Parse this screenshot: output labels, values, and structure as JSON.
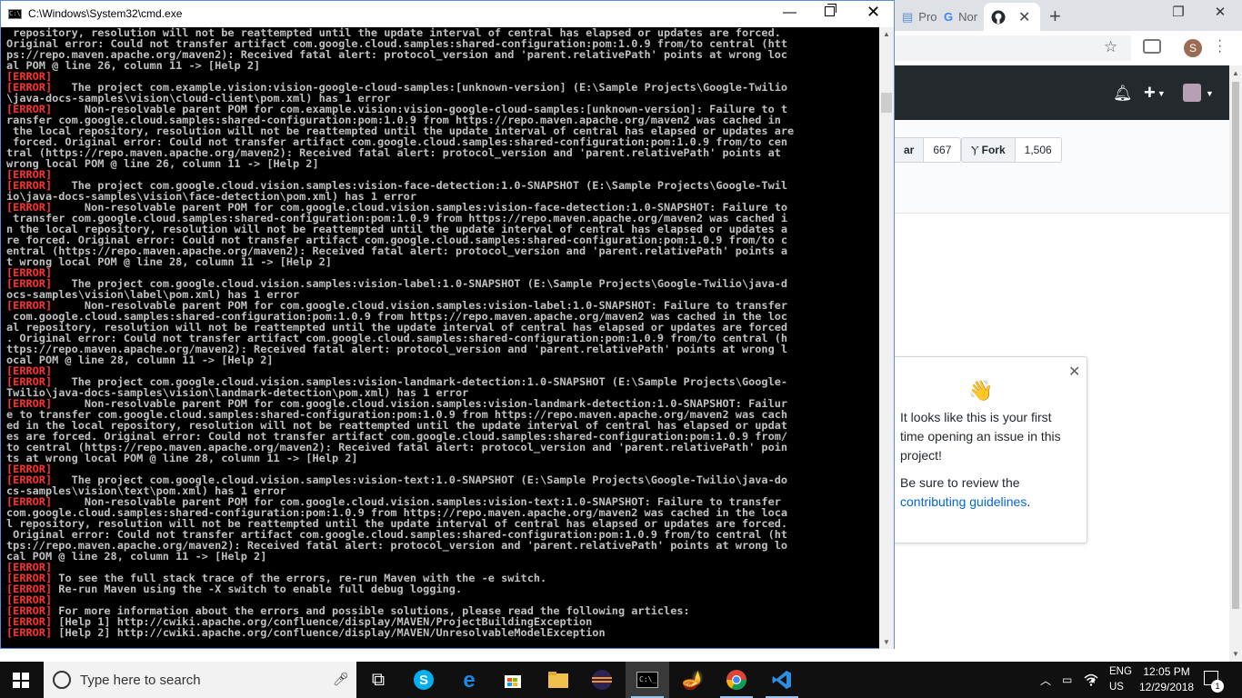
{
  "chrome": {
    "tabs": [
      {
        "label": "Pro"
      },
      {
        "label": "Nor"
      },
      {
        "label": ""
      }
    ],
    "new_tab": "+",
    "avatar_letter": "S"
  },
  "github": {
    "star_label": "ar",
    "star_count": "667",
    "fork_label": "Fork",
    "fork_count": "1,506",
    "popover": {
      "text1": "It looks like this is your first time opening an issue in this project!",
      "text2_pre": "Be sure to review the ",
      "text2_link": "contributing guidelines",
      "text2_post": "."
    }
  },
  "cmd": {
    "title": "C:\\Windows\\System32\\cmd.exe",
    "lines": [
      {
        "tag": "",
        "text": " repository, resolution will not be reattempted until the update interval of central has elapsed or updates are forced."
      },
      {
        "tag": "",
        "text": "Original error: Could not transfer artifact com.google.cloud.samples:shared-configuration:pom:1.0.9 from/to central (htt"
      },
      {
        "tag": "",
        "text": "ps://repo.maven.apache.org/maven2): Received fatal alert: protocol_version and 'parent.relativePath' points at wrong loc"
      },
      {
        "tag": "",
        "text": "al POM @ line 26, column 11 -> [Help 2]"
      },
      {
        "tag": "[ERROR]",
        "text": ""
      },
      {
        "tag": "[ERROR]",
        "text": "   The project com.example.vision:vision-google-cloud-samples:[unknown-version] (E:\\Sample Projects\\Google-Twilio"
      },
      {
        "tag": "",
        "text": "\\java-docs-samples\\vision\\cloud-client\\pom.xml) has 1 error"
      },
      {
        "tag": "[ERROR]",
        "text": "     Non-resolvable parent POM for com.example.vision:vision-google-cloud-samples:[unknown-version]: Failure to t"
      },
      {
        "tag": "",
        "text": "ransfer com.google.cloud.samples:shared-configuration:pom:1.0.9 from https://repo.maven.apache.org/maven2 was cached in"
      },
      {
        "tag": "",
        "text": " the local repository, resolution will not be reattempted until the update interval of central has elapsed or updates are"
      },
      {
        "tag": "",
        "text": " forced. Original error: Could not transfer artifact com.google.cloud.samples:shared-configuration:pom:1.0.9 from/to cen"
      },
      {
        "tag": "",
        "text": "tral (https://repo.maven.apache.org/maven2): Received fatal alert: protocol_version and 'parent.relativePath' points at"
      },
      {
        "tag": "",
        "text": "wrong local POM @ line 26, column 11 -> [Help 2]"
      },
      {
        "tag": "[ERROR]",
        "text": ""
      },
      {
        "tag": "[ERROR]",
        "text": "   The project com.google.cloud.vision.samples:vision-face-detection:1.0-SNAPSHOT (E:\\Sample Projects\\Google-Twil"
      },
      {
        "tag": "",
        "text": "io\\java-docs-samples\\vision\\face-detection\\pom.xml) has 1 error"
      },
      {
        "tag": "[ERROR]",
        "text": "     Non-resolvable parent POM for com.google.cloud.vision.samples:vision-face-detection:1.0-SNAPSHOT: Failure to"
      },
      {
        "tag": "",
        "text": " transfer com.google.cloud.samples:shared-configuration:pom:1.0.9 from https://repo.maven.apache.org/maven2 was cached i"
      },
      {
        "tag": "",
        "text": "n the local repository, resolution will not be reattempted until the update interval of central has elapsed or updates a"
      },
      {
        "tag": "",
        "text": "re forced. Original error: Could not transfer artifact com.google.cloud.samples:shared-configuration:pom:1.0.9 from/to c"
      },
      {
        "tag": "",
        "text": "entral (https://repo.maven.apache.org/maven2): Received fatal alert: protocol_version and 'parent.relativePath' points a"
      },
      {
        "tag": "",
        "text": "t wrong local POM @ line 28, column 11 -> [Help 2]"
      },
      {
        "tag": "[ERROR]",
        "text": ""
      },
      {
        "tag": "[ERROR]",
        "text": "   The project com.google.cloud.vision.samples:vision-label:1.0-SNAPSHOT (E:\\Sample Projects\\Google-Twilio\\java-d"
      },
      {
        "tag": "",
        "text": "ocs-samples\\vision\\label\\pom.xml) has 1 error"
      },
      {
        "tag": "[ERROR]",
        "text": "     Non-resolvable parent POM for com.google.cloud.vision.samples:vision-label:1.0-SNAPSHOT: Failure to transfer"
      },
      {
        "tag": "",
        "text": " com.google.cloud.samples:shared-configuration:pom:1.0.9 from https://repo.maven.apache.org/maven2 was cached in the loc"
      },
      {
        "tag": "",
        "text": "al repository, resolution will not be reattempted until the update interval of central has elapsed or updates are forced"
      },
      {
        "tag": "",
        "text": ". Original error: Could not transfer artifact com.google.cloud.samples:shared-configuration:pom:1.0.9 from/to central (h"
      },
      {
        "tag": "",
        "text": "ttps://repo.maven.apache.org/maven2): Received fatal alert: protocol_version and 'parent.relativePath' points at wrong l"
      },
      {
        "tag": "",
        "text": "ocal POM @ line 28, column 11 -> [Help 2]"
      },
      {
        "tag": "[ERROR]",
        "text": ""
      },
      {
        "tag": "[ERROR]",
        "text": "   The project com.google.cloud.vision.samples:vision-landmark-detection:1.0-SNAPSHOT (E:\\Sample Projects\\Google-"
      },
      {
        "tag": "",
        "text": "Twilio\\java-docs-samples\\vision\\landmark-detection\\pom.xml) has 1 error"
      },
      {
        "tag": "[ERROR]",
        "text": "     Non-resolvable parent POM for com.google.cloud.vision.samples:vision-landmark-detection:1.0-SNAPSHOT: Failur"
      },
      {
        "tag": "",
        "text": "e to transfer com.google.cloud.samples:shared-configuration:pom:1.0.9 from https://repo.maven.apache.org/maven2 was cach"
      },
      {
        "tag": "",
        "text": "ed in the local repository, resolution will not be reattempted until the update interval of central has elapsed or updat"
      },
      {
        "tag": "",
        "text": "es are forced. Original error: Could not transfer artifact com.google.cloud.samples:shared-configuration:pom:1.0.9 from/"
      },
      {
        "tag": "",
        "text": "to central (https://repo.maven.apache.org/maven2): Received fatal alert: protocol_version and 'parent.relativePath' poin"
      },
      {
        "tag": "",
        "text": "ts at wrong local POM @ line 28, column 11 -> [Help 2]"
      },
      {
        "tag": "[ERROR]",
        "text": ""
      },
      {
        "tag": "[ERROR]",
        "text": "   The project com.google.cloud.vision.samples:vision-text:1.0-SNAPSHOT (E:\\Sample Projects\\Google-Twilio\\java-do"
      },
      {
        "tag": "",
        "text": "cs-samples\\vision\\text\\pom.xml) has 1 error"
      },
      {
        "tag": "[ERROR]",
        "text": "     Non-resolvable parent POM for com.google.cloud.vision.samples:vision-text:1.0-SNAPSHOT: Failure to transfer"
      },
      {
        "tag": "",
        "text": "com.google.cloud.samples:shared-configuration:pom:1.0.9 from https://repo.maven.apache.org/maven2 was cached in the loca"
      },
      {
        "tag": "",
        "text": "l repository, resolution will not be reattempted until the update interval of central has elapsed or updates are forced."
      },
      {
        "tag": "",
        "text": " Original error: Could not transfer artifact com.google.cloud.samples:shared-configuration:pom:1.0.9 from/to central (ht"
      },
      {
        "tag": "",
        "text": "tps://repo.maven.apache.org/maven2): Received fatal alert: protocol_version and 'parent.relativePath' points at wrong lo"
      },
      {
        "tag": "",
        "text": "cal POM @ line 28, column 11 -> [Help 2]"
      },
      {
        "tag": "[ERROR]",
        "text": ""
      },
      {
        "tag": "[ERROR]",
        "text": " To see the full stack trace of the errors, re-run Maven with the -e switch."
      },
      {
        "tag": "[ERROR]",
        "text": " Re-run Maven using the -X switch to enable full debug logging."
      },
      {
        "tag": "[ERROR]",
        "text": ""
      },
      {
        "tag": "[ERROR]",
        "text": " For more information about the errors and possible solutions, please read the following articles:"
      },
      {
        "tag": "[ERROR]",
        "text": " [Help 1] http://cwiki.apache.org/confluence/display/MAVEN/ProjectBuildingException"
      },
      {
        "tag": "[ERROR]",
        "text": " [Help 2] http://cwiki.apache.org/confluence/display/MAVEN/UnresolvableModelException"
      },
      {
        "tag": "",
        "text": ""
      }
    ]
  },
  "taskbar": {
    "search_placeholder": "Type here to search",
    "language": "ENG",
    "region": "US",
    "time": "12:05 PM",
    "date": "12/29/2018",
    "notification_count": "1"
  },
  "colors": {
    "error_red": "#ff3030",
    "console_text": "#c0c0c0",
    "github_header": "#24292e",
    "link_blue": "#0366d6"
  }
}
